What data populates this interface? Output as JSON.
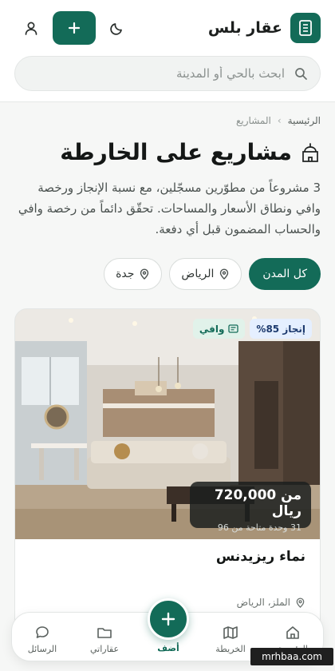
{
  "header": {
    "brand_name": "عقار بلس",
    "search_placeholder": "ابحث بالحي أو المدينة"
  },
  "breadcrumb": {
    "home": "الرئيسية",
    "separator": "›",
    "current": "المشاريع"
  },
  "page": {
    "title": "مشاريع على الخارطة",
    "intro": "3 مشروعاً من مطوّرين مسجّلين، مع نسبة الإنجاز ورخصة وافي ونطاق الأسعار والمساحات. تحقّق دائماً من رخصة وافي والحساب المضمون قبل أي دفعة."
  },
  "filters": [
    {
      "label": "كل المدن",
      "active": true
    },
    {
      "label": "الرياض",
      "active": false
    },
    {
      "label": "جدة",
      "active": false
    }
  ],
  "card": {
    "progress_badge": "إنجاز 85%",
    "wafi_badge": "وافي",
    "price": "من 720,000 ريال",
    "units": "31 وحدة متاحة من 96",
    "name": "نماء ريزيدنس",
    "location": "الملز، الرياض"
  },
  "bottom_nav": {
    "home": "الرئيسية",
    "map": "الخريطة",
    "add": "أضف",
    "my_properties": "عقاراتي",
    "messages": "الرسائل"
  },
  "watermark": "mrhbaa.com",
  "colors": {
    "brand": "#136b58",
    "badge_progress_bg": "#e5efff",
    "badge_wafi_bg": "#e1f2ea"
  },
  "icons": {
    "brand_logo": "building-icon",
    "add": "plus-icon",
    "theme": "moon-icon",
    "account": "user-icon",
    "search": "search-icon",
    "title": "mosque-icon",
    "location": "map-pin-icon"
  }
}
